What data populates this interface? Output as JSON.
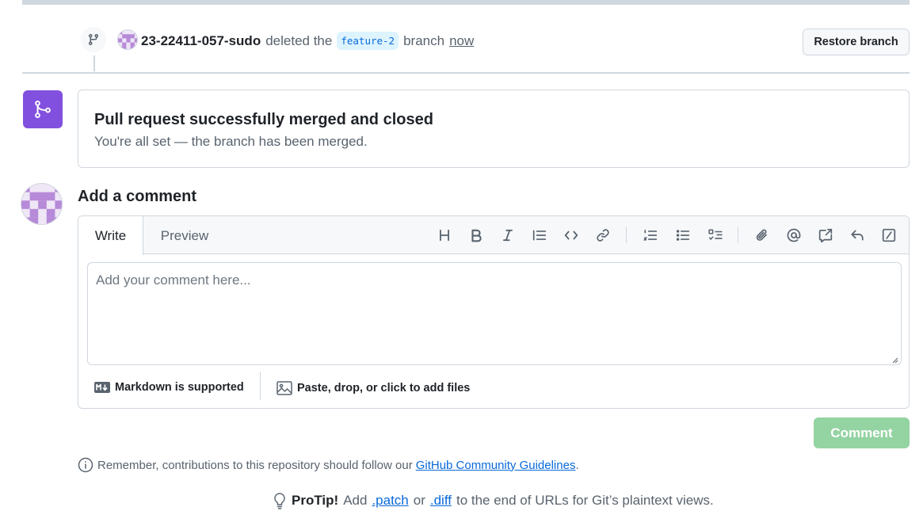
{
  "event": {
    "user": "23-22411-057-sudo",
    "action": "deleted the",
    "branch": "feature-2",
    "branch_word": "branch",
    "time": "now",
    "restore_label": "Restore branch"
  },
  "merged": {
    "title": "Pull request successfully merged and closed",
    "subtitle": "You're all set — the branch has been merged."
  },
  "comment": {
    "heading": "Add a comment",
    "tabs": [
      "Write",
      "Preview"
    ],
    "placeholder": "Add your comment here...",
    "markdown_note": "Markdown is supported",
    "files_note": "Paste, drop, or click to add files",
    "submit_label": "Comment",
    "toolbar_icons": [
      "heading-icon",
      "bold-icon",
      "italic-icon",
      "quote-icon",
      "code-icon",
      "link-icon",
      "numbered-list-icon",
      "unordered-list-icon",
      "task-list-icon",
      "attach-icon",
      "mention-icon",
      "reference-icon",
      "reply-icon",
      "slash-command-icon"
    ]
  },
  "footer": {
    "remember_text": "Remember, contributions to this repository should follow our",
    "guidelines_link": "GitHub Community Guidelines",
    "period": ".",
    "protip_label": "ProTip!",
    "protip_add": "Add",
    "patch": ".patch",
    "or": "or",
    "diff": ".diff",
    "protip_rest": "to the end of URLs for Git’s plaintext views."
  },
  "colors": {
    "merged_purple": "#8250df",
    "link_blue": "#0969da",
    "comment_button_disabled": "#94d3a2",
    "border": "#d0d7de"
  }
}
